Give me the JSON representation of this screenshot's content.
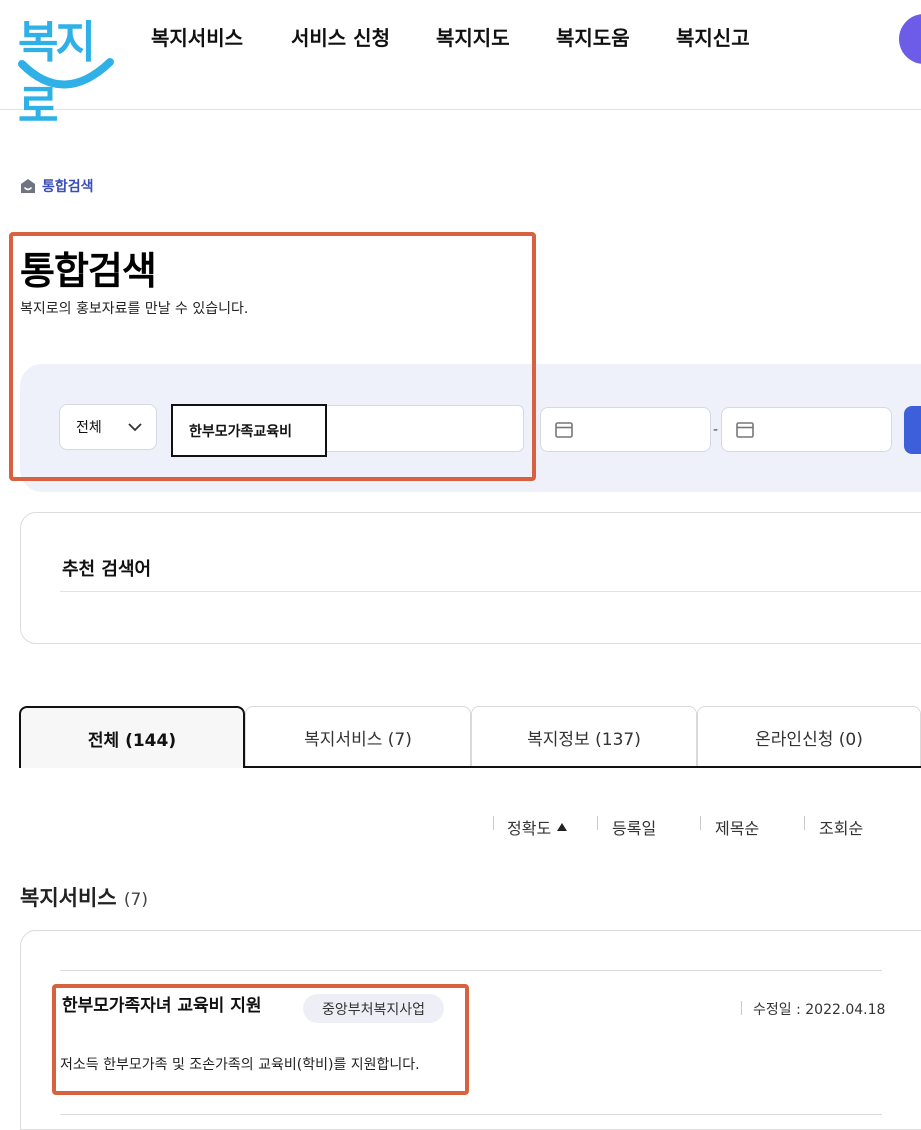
{
  "header": {
    "logo_text": "복지로",
    "nav": [
      "복지서비스",
      "서비스 신청",
      "복지지도",
      "복지도움",
      "복지신고"
    ]
  },
  "breadcrumb": {
    "label": "통합검색"
  },
  "page": {
    "title": "통합검색",
    "subtitle": "복지로의 홍보자료를 만날 수 있습니다."
  },
  "search": {
    "category_value": "전체",
    "query_value": "한부모가족교육비",
    "date_separator": "-"
  },
  "recommended": {
    "title": "추천 검색어"
  },
  "tabs": [
    {
      "label": "전체 (144)",
      "active": true
    },
    {
      "label": "복지서비스 (7)",
      "active": false
    },
    {
      "label": "복지정보 (137)",
      "active": false
    },
    {
      "label": "온라인신청 (0)",
      "active": false
    }
  ],
  "sort": {
    "accuracy": "정확도",
    "registered": "등록일",
    "title": "제목순",
    "views": "조회순"
  },
  "section": {
    "title": "복지서비스",
    "count": "(7)"
  },
  "results": [
    {
      "title": "한부모가족자녀 교육비 지원",
      "badge": "중앙부처복지사업",
      "description": "저소득 한부모가족 및 조손가족의 교육비(학비)를 지원합니다.",
      "date_label": "수정일",
      "date_value": "2022.04.18"
    }
  ],
  "colors": {
    "logo_blue": "#2fb1e8",
    "accent_blue": "#3d5fd9",
    "annotation_orange": "#d8623f",
    "panel_bg": "#eef1fa"
  }
}
